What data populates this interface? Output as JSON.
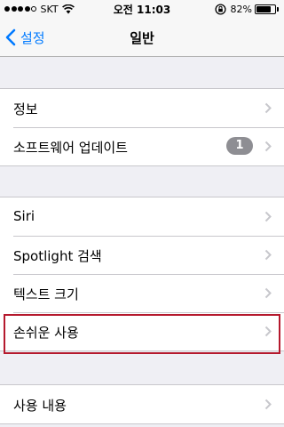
{
  "status_bar": {
    "carrier": "SKT",
    "time": "오전 11:03",
    "battery_percent_text": "82%",
    "battery_level": 0.82,
    "signal_bars_filled": 4,
    "signal_bars_total": 5
  },
  "nav": {
    "back_label": "설정",
    "title": "일반"
  },
  "groups": [
    {
      "rows": [
        {
          "label": "정보"
        },
        {
          "label": "소프트웨어 업데이트",
          "badge": "1"
        }
      ]
    },
    {
      "rows": [
        {
          "label": "Siri"
        },
        {
          "label": "Spotlight 검색"
        },
        {
          "label": "텍스트 크기"
        },
        {
          "label": "손쉬운 사용",
          "highlighted": true
        }
      ]
    },
    {
      "rows": [
        {
          "label": "사용 내용"
        }
      ]
    }
  ],
  "colors": {
    "accent": "#007aff",
    "highlight_border": "#b5192d",
    "badge": "#8e8e93",
    "background": "#efeff4"
  }
}
